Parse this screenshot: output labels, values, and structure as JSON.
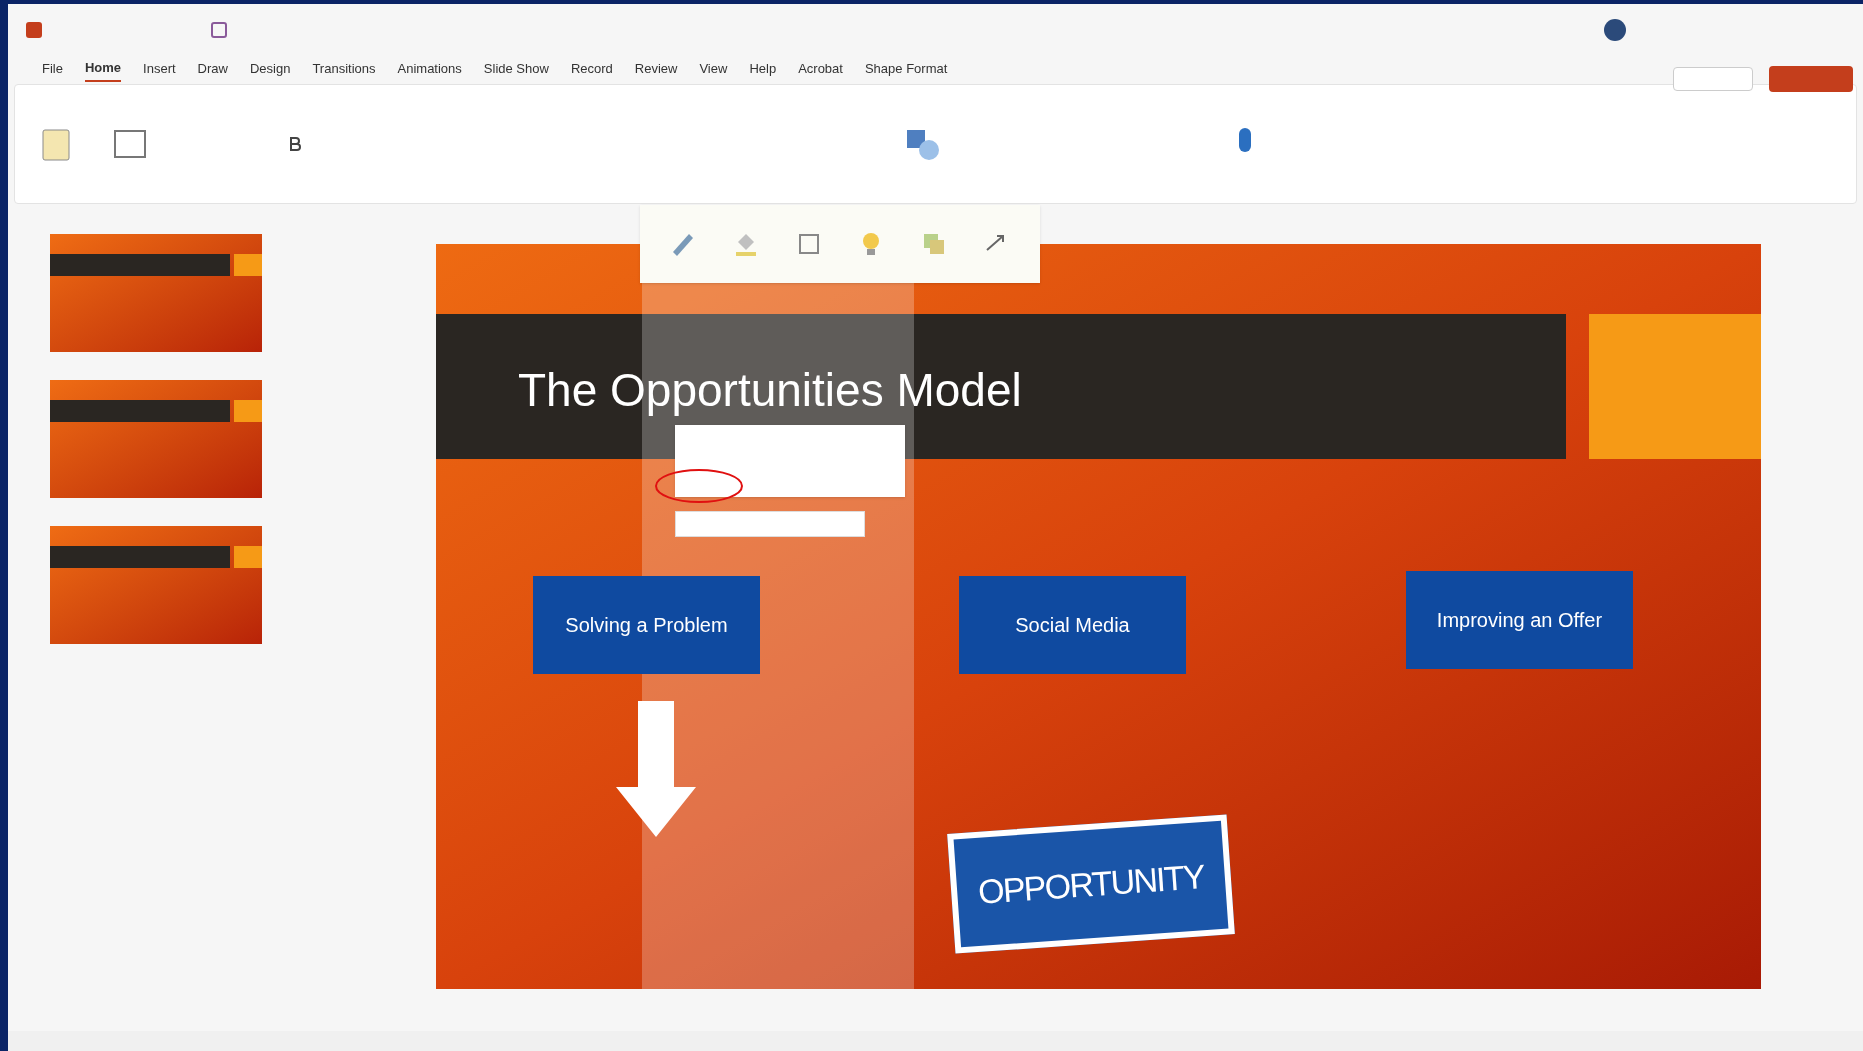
{
  "ribbon_tabs": [
    {
      "label": "File",
      "selected": false
    },
    {
      "label": "Home",
      "selected": true
    },
    {
      "label": "Insert",
      "selected": false
    },
    {
      "label": "Draw",
      "selected": false
    },
    {
      "label": "Design",
      "selected": false
    },
    {
      "label": "Transitions",
      "selected": false
    },
    {
      "label": "Animations",
      "selected": false
    },
    {
      "label": "Slide Show",
      "selected": false
    },
    {
      "label": "Record",
      "selected": false
    },
    {
      "label": "Review",
      "selected": false
    },
    {
      "label": "View",
      "selected": false
    },
    {
      "label": "Help",
      "selected": false
    },
    {
      "label": "Acrobat",
      "selected": false
    },
    {
      "label": "Shape Format",
      "selected": false
    }
  ],
  "slide": {
    "title": "The Opportunities Model",
    "boxes": [
      "Solving a Problem",
      "Social Media",
      "Improving an Offer"
    ],
    "stamp": "OPPORTUNITY"
  }
}
